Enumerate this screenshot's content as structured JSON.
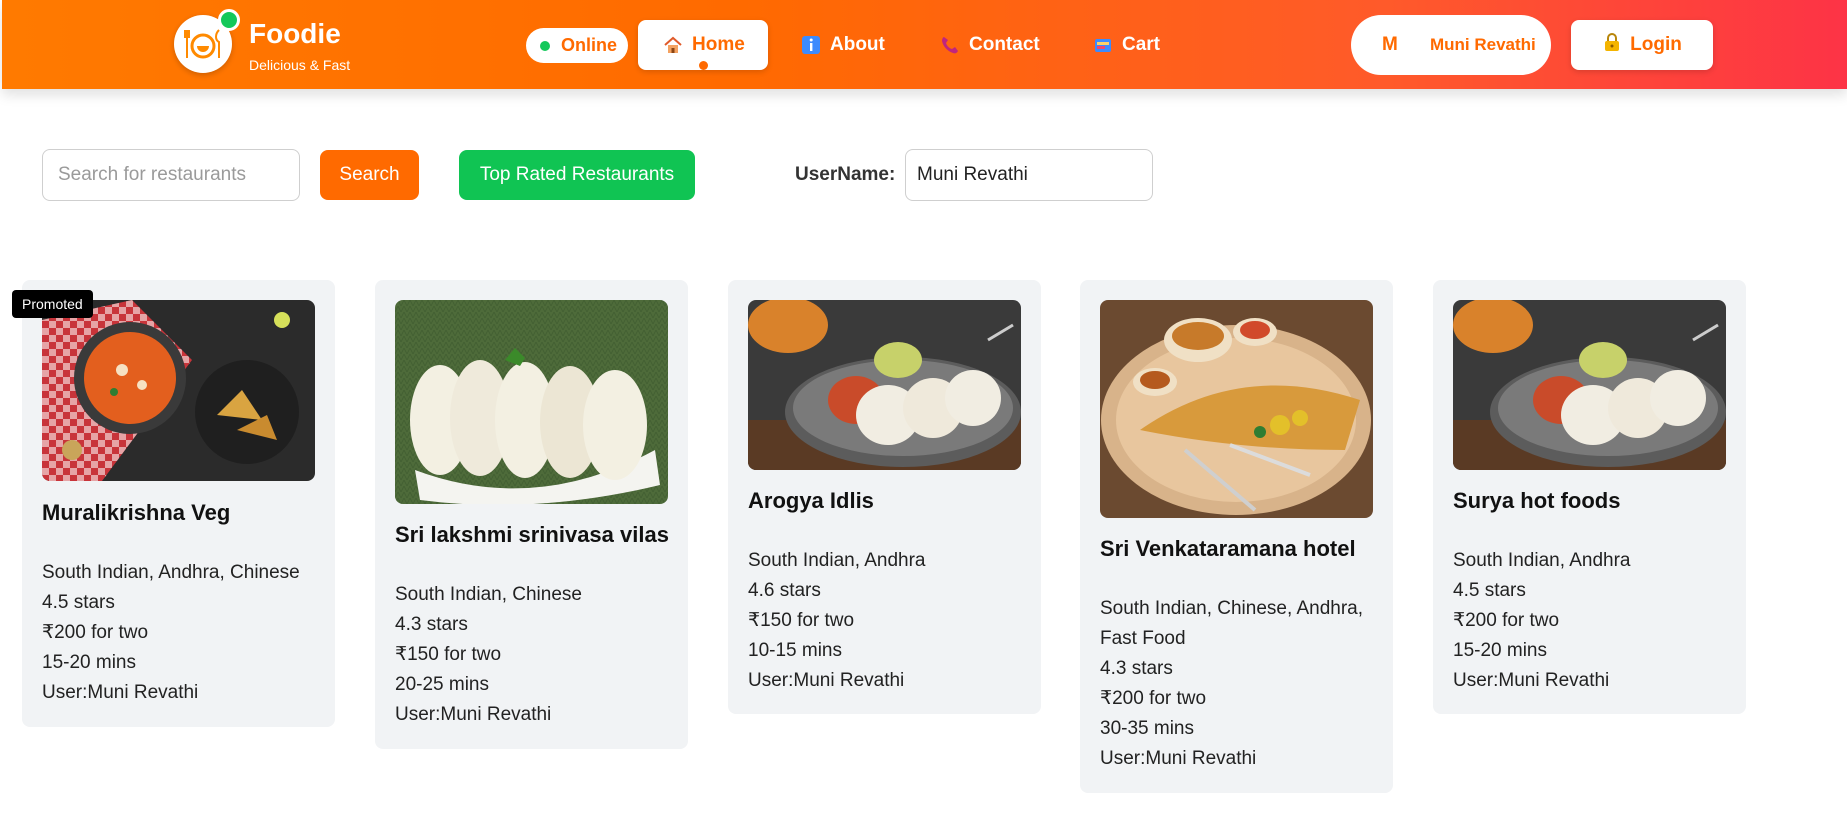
{
  "header": {
    "brand": "Foodie",
    "tagline": "Delicious & Fast",
    "status": "Online",
    "nav": [
      {
        "label": "Home",
        "icon": "house-icon"
      },
      {
        "label": "About",
        "icon": "info-icon"
      },
      {
        "label": "Contact",
        "icon": "phone-icon"
      },
      {
        "label": "Cart",
        "icon": "cart-icon"
      }
    ],
    "user_initial": "M",
    "user_name": "Muni Revathi",
    "login_label": "Login"
  },
  "toolbar": {
    "search_placeholder": "Search for restaurants",
    "search_button": "Search",
    "top_rated_button": "Top Rated Restaurants",
    "username_label": "UserName:",
    "username_value": "Muni Revathi"
  },
  "restaurants": [
    {
      "promoted_badge": "Promoted",
      "name": "Muralikrishna Veg",
      "cuisines": "South Indian, Andhra, Chinese",
      "rating": "4.5 stars",
      "cost": "₹200 for two",
      "time": "15-20 mins",
      "user": "User:Muni Revathi"
    },
    {
      "name": "Sri lakshmi srinivasa vilas",
      "cuisines": "South Indian, Chinese",
      "rating": "4.3 stars",
      "cost": "₹150 for two",
      "time": "20-25 mins",
      "user": "User:Muni Revathi"
    },
    {
      "name": "Arogya Idlis",
      "cuisines": "South Indian, Andhra",
      "rating": "4.6 stars",
      "cost": "₹150 for two",
      "time": "10-15 mins",
      "user": "User:Muni Revathi"
    },
    {
      "name": "Sri Venkataramana hotel",
      "cuisines": "South Indian, Chinese, Andhra, Fast Food",
      "rating": "4.3 stars",
      "cost": "₹200 for two",
      "time": "30-35 mins",
      "user": "User:Muni Revathi"
    },
    {
      "name": "Surya hot foods",
      "cuisines": "South Indian, Andhra",
      "rating": "4.5 stars",
      "cost": "₹200 for two",
      "time": "15-20 mins",
      "user": "User:Muni Revathi"
    }
  ],
  "colors": {
    "brand_orange": "#ff6a00",
    "header_end": "#fd3346",
    "online_green": "#14c85a",
    "top_rated_green": "#10c453",
    "card_bg": "#f1f3f5"
  }
}
